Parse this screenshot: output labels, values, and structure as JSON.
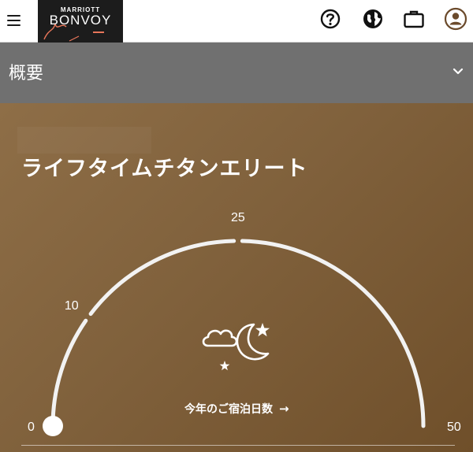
{
  "header": {
    "menu_icon": "hamburger-menu-icon",
    "logo": {
      "top": "MARRIOTT",
      "main": "BONVOY"
    },
    "icons": [
      "help-icon",
      "globe-icon",
      "briefcase-icon",
      "account-icon"
    ]
  },
  "overview": {
    "title": "概要",
    "chevron_icon": "chevron-down-icon"
  },
  "status": {
    "tier_title": "ライフタイムチタンエリート",
    "gauge": {
      "min": 0,
      "max": 50,
      "current": 0,
      "ticks": [
        {
          "value": 0,
          "label": "0"
        },
        {
          "value": 10,
          "label": "10"
        },
        {
          "value": 25,
          "label": "25"
        },
        {
          "value": 50,
          "label": "50"
        }
      ]
    },
    "center_icon": "night-moon-stars-icon",
    "stays_link": "今年のご宿泊日数",
    "stays_arrow": "→"
  },
  "colors": {
    "card_bg": "#80613c",
    "overview_bg": "#707070",
    "logo_bg": "#1c1c1c",
    "gauge_track": "#f2f2f2"
  }
}
